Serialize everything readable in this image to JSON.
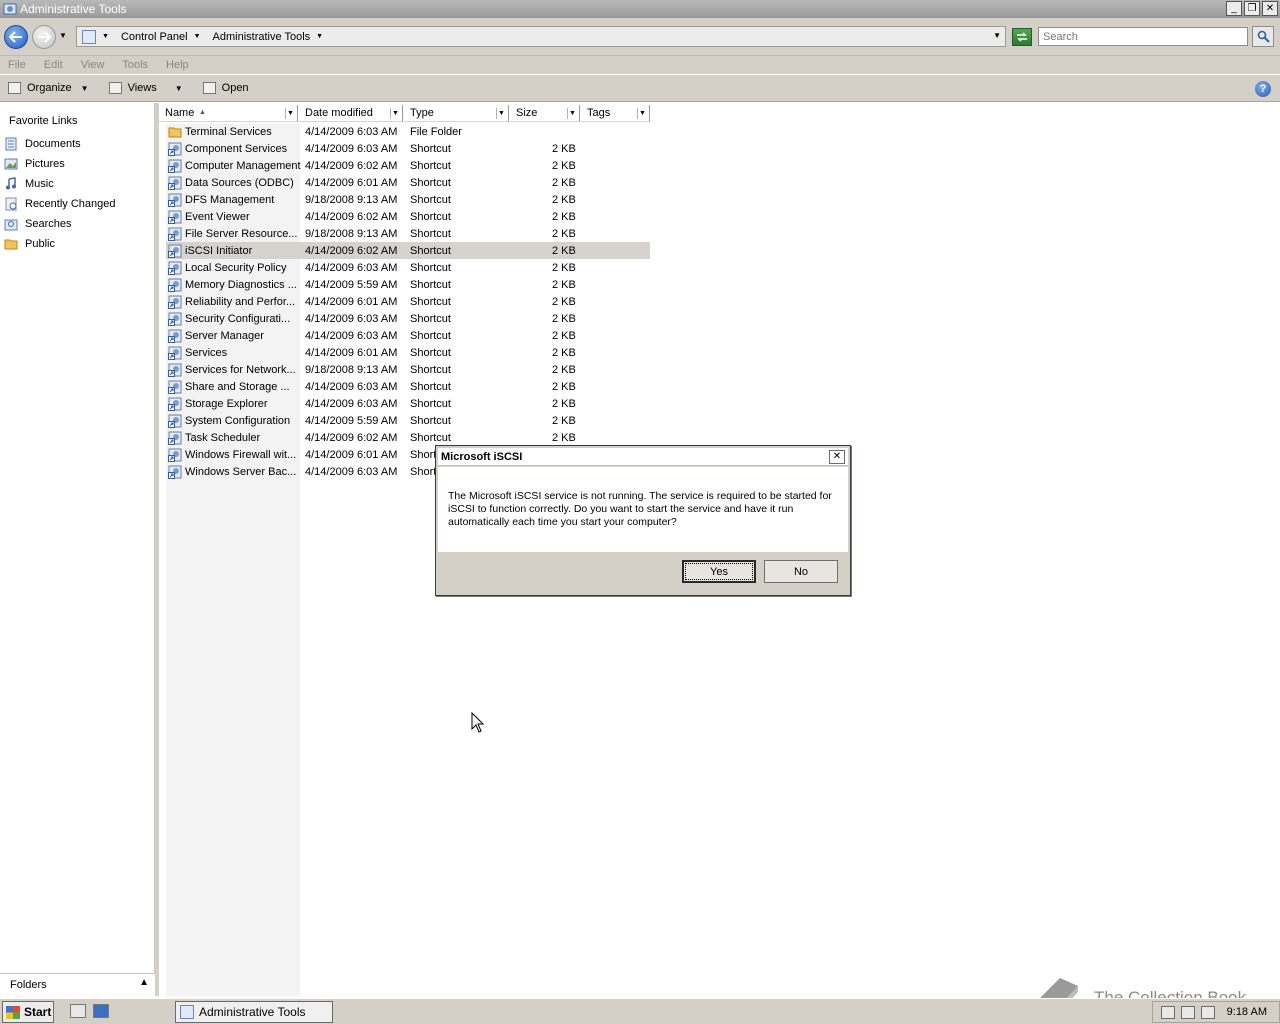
{
  "window": {
    "title": "Administrative Tools",
    "minimize": "_",
    "restore": "❐",
    "close": "✕"
  },
  "address": {
    "crumbs": [
      "Control Panel",
      "Administrative Tools"
    ],
    "search_placeholder": "Search"
  },
  "menu": [
    "File",
    "Edit",
    "View",
    "Tools",
    "Help"
  ],
  "toolbar": {
    "organize": "Organize",
    "views": "Views",
    "open": "Open",
    "help": "?"
  },
  "navpane": {
    "heading": "Favorite Links",
    "items": [
      "Documents",
      "Pictures",
      "Music",
      "Recently Changed",
      "Searches",
      "Public"
    ],
    "folders": "Folders"
  },
  "columns": {
    "name": "Name",
    "date": "Date modified",
    "type": "Type",
    "size": "Size",
    "tags": "Tags"
  },
  "files": [
    {
      "name": "Terminal Services",
      "date": "4/14/2009 6:03 AM",
      "type": "File Folder",
      "size": ""
    },
    {
      "name": "Component Services",
      "date": "4/14/2009 6:03 AM",
      "type": "Shortcut",
      "size": "2 KB"
    },
    {
      "name": "Computer Management",
      "date": "4/14/2009 6:02 AM",
      "type": "Shortcut",
      "size": "2 KB"
    },
    {
      "name": "Data Sources (ODBC)",
      "date": "4/14/2009 6:01 AM",
      "type": "Shortcut",
      "size": "2 KB"
    },
    {
      "name": "DFS Management",
      "date": "9/18/2008 9:13 AM",
      "type": "Shortcut",
      "size": "2 KB"
    },
    {
      "name": "Event Viewer",
      "date": "4/14/2009 6:02 AM",
      "type": "Shortcut",
      "size": "2 KB"
    },
    {
      "name": "File Server Resource...",
      "date": "9/18/2008 9:13 AM",
      "type": "Shortcut",
      "size": "2 KB"
    },
    {
      "name": "iSCSI Initiator",
      "date": "4/14/2009 6:02 AM",
      "type": "Shortcut",
      "size": "2 KB"
    },
    {
      "name": "Local Security Policy",
      "date": "4/14/2009 6:03 AM",
      "type": "Shortcut",
      "size": "2 KB"
    },
    {
      "name": "Memory Diagnostics ...",
      "date": "4/14/2009 5:59 AM",
      "type": "Shortcut",
      "size": "2 KB"
    },
    {
      "name": "Reliability and Perfor...",
      "date": "4/14/2009 6:01 AM",
      "type": "Shortcut",
      "size": "2 KB"
    },
    {
      "name": "Security Configurati...",
      "date": "4/14/2009 6:03 AM",
      "type": "Shortcut",
      "size": "2 KB"
    },
    {
      "name": "Server Manager",
      "date": "4/14/2009 6:03 AM",
      "type": "Shortcut",
      "size": "2 KB"
    },
    {
      "name": "Services",
      "date": "4/14/2009 6:01 AM",
      "type": "Shortcut",
      "size": "2 KB"
    },
    {
      "name": "Services for Network...",
      "date": "9/18/2008 9:13 AM",
      "type": "Shortcut",
      "size": "2 KB"
    },
    {
      "name": "Share and Storage ...",
      "date": "4/14/2009 6:03 AM",
      "type": "Shortcut",
      "size": "2 KB"
    },
    {
      "name": "Storage Explorer",
      "date": "4/14/2009 6:03 AM",
      "type": "Shortcut",
      "size": "2 KB"
    },
    {
      "name": "System Configuration",
      "date": "4/14/2009 5:59 AM",
      "type": "Shortcut",
      "size": "2 KB"
    },
    {
      "name": "Task Scheduler",
      "date": "4/14/2009 6:02 AM",
      "type": "Shortcut",
      "size": "2 KB"
    },
    {
      "name": "Windows Firewall wit...",
      "date": "4/14/2009 6:01 AM",
      "type": "Short",
      "size": ""
    },
    {
      "name": "Windows Server Bac...",
      "date": "4/14/2009 6:03 AM",
      "type": "Short",
      "size": ""
    }
  ],
  "selected_file": "iSCSI Initiator",
  "dialog": {
    "title": "Microsoft iSCSI",
    "message": "The Microsoft iSCSI service is not running. The service is required to be started for iSCSI to function correctly. Do you want to start the service and have it run automatically each time you start your computer?",
    "yes": "Yes",
    "no": "No",
    "close": "✕"
  },
  "taskbar": {
    "start": "Start",
    "task": "Administrative Tools",
    "clock": "9:18 AM"
  },
  "watermark": "The Collection Book",
  "colors": {
    "selection": "#d6d3ce",
    "chrome": "#d4d0c8",
    "accent_blue": "#1f5fc1"
  }
}
